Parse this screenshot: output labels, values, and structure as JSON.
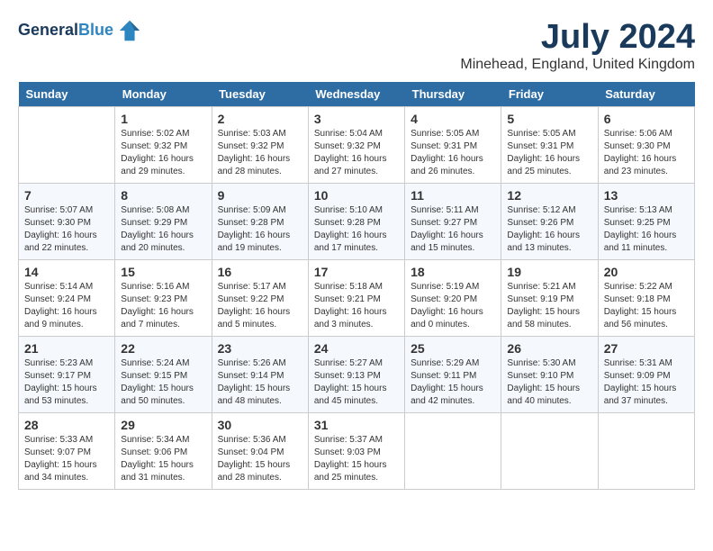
{
  "header": {
    "logo_line1": "General",
    "logo_line2": "Blue",
    "month_year": "July 2024",
    "location": "Minehead, England, United Kingdom"
  },
  "weekdays": [
    "Sunday",
    "Monday",
    "Tuesday",
    "Wednesday",
    "Thursday",
    "Friday",
    "Saturday"
  ],
  "weeks": [
    [
      {
        "day": "",
        "sunrise": "",
        "sunset": "",
        "daylight": ""
      },
      {
        "day": "1",
        "sunrise": "Sunrise: 5:02 AM",
        "sunset": "Sunset: 9:32 PM",
        "daylight": "Daylight: 16 hours and 29 minutes."
      },
      {
        "day": "2",
        "sunrise": "Sunrise: 5:03 AM",
        "sunset": "Sunset: 9:32 PM",
        "daylight": "Daylight: 16 hours and 28 minutes."
      },
      {
        "day": "3",
        "sunrise": "Sunrise: 5:04 AM",
        "sunset": "Sunset: 9:32 PM",
        "daylight": "Daylight: 16 hours and 27 minutes."
      },
      {
        "day": "4",
        "sunrise": "Sunrise: 5:05 AM",
        "sunset": "Sunset: 9:31 PM",
        "daylight": "Daylight: 16 hours and 26 minutes."
      },
      {
        "day": "5",
        "sunrise": "Sunrise: 5:05 AM",
        "sunset": "Sunset: 9:31 PM",
        "daylight": "Daylight: 16 hours and 25 minutes."
      },
      {
        "day": "6",
        "sunrise": "Sunrise: 5:06 AM",
        "sunset": "Sunset: 9:30 PM",
        "daylight": "Daylight: 16 hours and 23 minutes."
      }
    ],
    [
      {
        "day": "7",
        "sunrise": "Sunrise: 5:07 AM",
        "sunset": "Sunset: 9:30 PM",
        "daylight": "Daylight: 16 hours and 22 minutes."
      },
      {
        "day": "8",
        "sunrise": "Sunrise: 5:08 AM",
        "sunset": "Sunset: 9:29 PM",
        "daylight": "Daylight: 16 hours and 20 minutes."
      },
      {
        "day": "9",
        "sunrise": "Sunrise: 5:09 AM",
        "sunset": "Sunset: 9:28 PM",
        "daylight": "Daylight: 16 hours and 19 minutes."
      },
      {
        "day": "10",
        "sunrise": "Sunrise: 5:10 AM",
        "sunset": "Sunset: 9:28 PM",
        "daylight": "Daylight: 16 hours and 17 minutes."
      },
      {
        "day": "11",
        "sunrise": "Sunrise: 5:11 AM",
        "sunset": "Sunset: 9:27 PM",
        "daylight": "Daylight: 16 hours and 15 minutes."
      },
      {
        "day": "12",
        "sunrise": "Sunrise: 5:12 AM",
        "sunset": "Sunset: 9:26 PM",
        "daylight": "Daylight: 16 hours and 13 minutes."
      },
      {
        "day": "13",
        "sunrise": "Sunrise: 5:13 AM",
        "sunset": "Sunset: 9:25 PM",
        "daylight": "Daylight: 16 hours and 11 minutes."
      }
    ],
    [
      {
        "day": "14",
        "sunrise": "Sunrise: 5:14 AM",
        "sunset": "Sunset: 9:24 PM",
        "daylight": "Daylight: 16 hours and 9 minutes."
      },
      {
        "day": "15",
        "sunrise": "Sunrise: 5:16 AM",
        "sunset": "Sunset: 9:23 PM",
        "daylight": "Daylight: 16 hours and 7 minutes."
      },
      {
        "day": "16",
        "sunrise": "Sunrise: 5:17 AM",
        "sunset": "Sunset: 9:22 PM",
        "daylight": "Daylight: 16 hours and 5 minutes."
      },
      {
        "day": "17",
        "sunrise": "Sunrise: 5:18 AM",
        "sunset": "Sunset: 9:21 PM",
        "daylight": "Daylight: 16 hours and 3 minutes."
      },
      {
        "day": "18",
        "sunrise": "Sunrise: 5:19 AM",
        "sunset": "Sunset: 9:20 PM",
        "daylight": "Daylight: 16 hours and 0 minutes."
      },
      {
        "day": "19",
        "sunrise": "Sunrise: 5:21 AM",
        "sunset": "Sunset: 9:19 PM",
        "daylight": "Daylight: 15 hours and 58 minutes."
      },
      {
        "day": "20",
        "sunrise": "Sunrise: 5:22 AM",
        "sunset": "Sunset: 9:18 PM",
        "daylight": "Daylight: 15 hours and 56 minutes."
      }
    ],
    [
      {
        "day": "21",
        "sunrise": "Sunrise: 5:23 AM",
        "sunset": "Sunset: 9:17 PM",
        "daylight": "Daylight: 15 hours and 53 minutes."
      },
      {
        "day": "22",
        "sunrise": "Sunrise: 5:24 AM",
        "sunset": "Sunset: 9:15 PM",
        "daylight": "Daylight: 15 hours and 50 minutes."
      },
      {
        "day": "23",
        "sunrise": "Sunrise: 5:26 AM",
        "sunset": "Sunset: 9:14 PM",
        "daylight": "Daylight: 15 hours and 48 minutes."
      },
      {
        "day": "24",
        "sunrise": "Sunrise: 5:27 AM",
        "sunset": "Sunset: 9:13 PM",
        "daylight": "Daylight: 15 hours and 45 minutes."
      },
      {
        "day": "25",
        "sunrise": "Sunrise: 5:29 AM",
        "sunset": "Sunset: 9:11 PM",
        "daylight": "Daylight: 15 hours and 42 minutes."
      },
      {
        "day": "26",
        "sunrise": "Sunrise: 5:30 AM",
        "sunset": "Sunset: 9:10 PM",
        "daylight": "Daylight: 15 hours and 40 minutes."
      },
      {
        "day": "27",
        "sunrise": "Sunrise: 5:31 AM",
        "sunset": "Sunset: 9:09 PM",
        "daylight": "Daylight: 15 hours and 37 minutes."
      }
    ],
    [
      {
        "day": "28",
        "sunrise": "Sunrise: 5:33 AM",
        "sunset": "Sunset: 9:07 PM",
        "daylight": "Daylight: 15 hours and 34 minutes."
      },
      {
        "day": "29",
        "sunrise": "Sunrise: 5:34 AM",
        "sunset": "Sunset: 9:06 PM",
        "daylight": "Daylight: 15 hours and 31 minutes."
      },
      {
        "day": "30",
        "sunrise": "Sunrise: 5:36 AM",
        "sunset": "Sunset: 9:04 PM",
        "daylight": "Daylight: 15 hours and 28 minutes."
      },
      {
        "day": "31",
        "sunrise": "Sunrise: 5:37 AM",
        "sunset": "Sunset: 9:03 PM",
        "daylight": "Daylight: 15 hours and 25 minutes."
      },
      {
        "day": "",
        "sunrise": "",
        "sunset": "",
        "daylight": ""
      },
      {
        "day": "",
        "sunrise": "",
        "sunset": "",
        "daylight": ""
      },
      {
        "day": "",
        "sunrise": "",
        "sunset": "",
        "daylight": ""
      }
    ]
  ]
}
